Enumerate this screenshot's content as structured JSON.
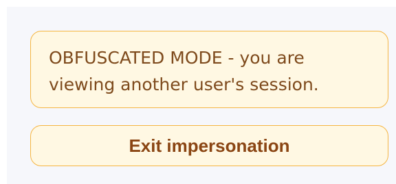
{
  "impersonation": {
    "notice_text": "OBFUSCATED MODE - you are viewing another user's session.",
    "exit_label": "Exit impersonation"
  },
  "colors": {
    "panel_background": "#f6f7fb",
    "box_background": "#fff8e3",
    "box_border": "#f5b541",
    "text": "#7e4a1c",
    "button_text": "#8a4513"
  }
}
